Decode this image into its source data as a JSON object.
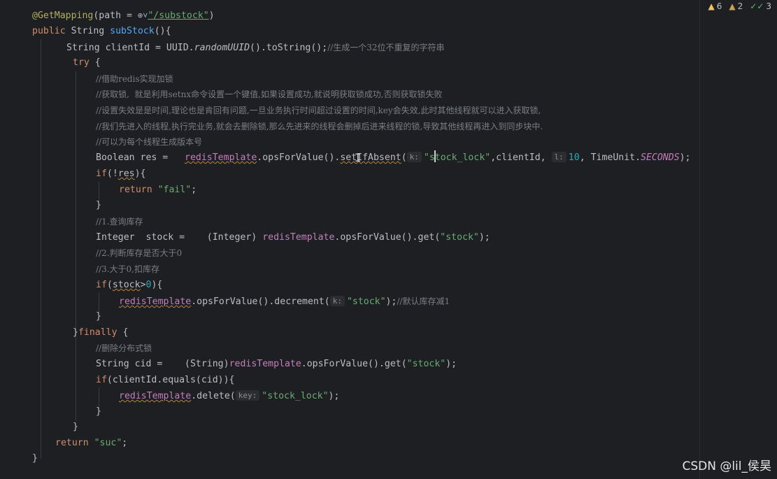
{
  "inspections": {
    "errors_count": "6",
    "warnings_count": "2",
    "ok_count": "3",
    "errors_icon": "warning-triangle-icon",
    "warnings_icon": "weak-warning-triangle-icon",
    "ok_icon": "double-check-icon"
  },
  "code": {
    "l1_annotation": "@GetMapping",
    "l1_rest": "(path = ",
    "l1_path": "\"/substock\"",
    "l1_close": ")",
    "l2_kw": "public",
    "l2_type": " String ",
    "l2_method": "subStock",
    "l2_rest": "(){",
    "l3_code": "String clientId = UUID.",
    "l3_method": "randomUUID",
    "l3_rest": "().toString();",
    "l3_comment": "//生成一个32位不重复的字符串",
    "l4_kw": "try",
    "l4_rest": " {",
    "l5_comment": "//借助redis实现加锁",
    "l6_comment": "//获取锁,  就是利用setnx命令设置一个键值,如果设置成功,就说明获取锁成功,否则获取锁失败",
    "l7_comment": "//设置失效是是时间,理论也是肯回有问题,一旦业务执行时间超过设置的时间,key会失效,此时其他线程就可以进入获取锁,",
    "l8_comment": "//我们先进入的线程,执行完业务,就会去删除锁,那么先进来的线程会删掉后进来线程的锁,导致其他线程再进入到同步块中.",
    "l9_comment": "//可以为每个线程生成版本号",
    "l10_decl": "Boolean res =   ",
    "l10_field": "redisTemplate",
    "l10_mid": ".opsForValue().",
    "l10_method": "setIfAbsent",
    "l10_open": "(",
    "l10_hint_k": "k:",
    "l10_str_a": "\"s",
    "l10_str_b": "tock_lock\"",
    "l10_mid2": ",clientId, ",
    "l10_hint_l": "l:",
    "l10_num": "10",
    "l10_mid3": ", TimeUnit.",
    "l10_const": "SECONDS",
    "l10_end": ");",
    "l11_kw": "if",
    "l11_a": "(!",
    "l11_var": "res",
    "l11_b": "){",
    "l12_kw": "return",
    "l12_str": "\"fail\"",
    "l12_end": ";",
    "l13": "}",
    "l14_comment": "//1.查询库存",
    "l15_decl": "Integer  stock =    (Integer) ",
    "l15_field": "redisTemplate",
    "l15_mid": ".opsForValue().get(",
    "l15_str": "\"stock\"",
    "l15_end": ");",
    "l16_comment": "//2.判断库存是否大于0",
    "l17_comment": "//3.大于0,扣库存",
    "l18_kw": "if",
    "l18_a": "(",
    "l18_var": "stock",
    "l18_op": ">",
    "l18_num": "0",
    "l18_b": "){",
    "l19_field": "redisTemplate",
    "l19_mid": ".opsForValue().decrement(",
    "l19_hint": "k:",
    "l19_str": "\"stock\"",
    "l19_end": ");",
    "l19_comment": "//默认库存减1",
    "l20": "}",
    "l21_a": "}",
    "l21_kw": "finally",
    "l21_b": " {",
    "l22_comment": "//删除分布式锁",
    "l23_decl": "String cid =    (String)",
    "l23_field": "redisTemplate",
    "l23_mid": ".opsForValue().get(",
    "l23_str": "\"stock\"",
    "l23_end": ");",
    "l24_kw": "if",
    "l24_rest": "(clientId.equals(cid)){",
    "l25_field": "redisTemplate",
    "l25_mid": ".delete(",
    "l25_hint": "key:",
    "l25_str": "\"stock_lock\"",
    "l25_end": ");",
    "l26": "}",
    "l27": "}",
    "l28_kw": "return",
    "l28_str": "\"suc\"",
    "l28_end": ";",
    "l29": "}"
  },
  "watermark": "CSDN @lil_侯昊"
}
